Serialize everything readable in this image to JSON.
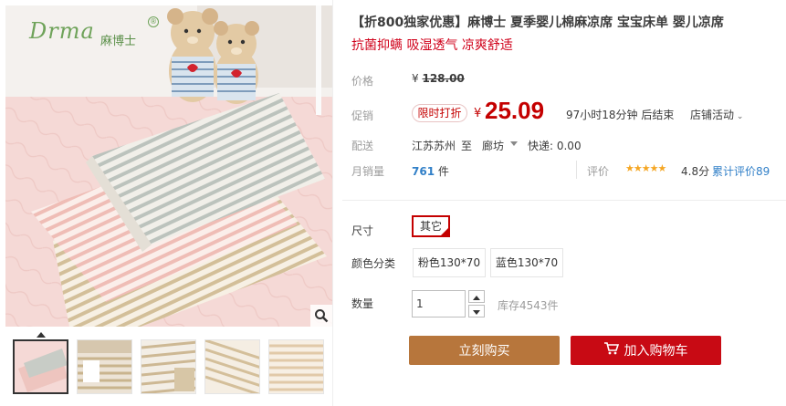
{
  "brand": {
    "logo_script": "Drma",
    "logo_cn": "麻博士",
    "logo_mark": "®"
  },
  "gallery": {
    "main_image": "baby-mat-product-photo",
    "zoom_icon": "magnifier-icon",
    "thumbnails": [
      "thumb-1",
      "thumb-2",
      "thumb-3",
      "thumb-4",
      "thumb-5"
    ],
    "active_index": 0
  },
  "product": {
    "title": "【折800独家优惠】麻博士 夏季婴儿棉麻凉席 宝宝床单 婴儿凉席",
    "subtitle": "抗菌抑螨 吸湿透气 凉爽舒适"
  },
  "price": {
    "label": "价格",
    "original_currency": "¥",
    "original": "128.00",
    "promo_label": "促销",
    "promo_tag": "限时打折",
    "current_currency": "¥",
    "current": "25.09",
    "countdown": "97小时18分钟 后结束",
    "store_activity": "店铺活动"
  },
  "shipping": {
    "label": "配送",
    "from": "江苏苏州",
    "to_word": "至",
    "to_city": "廊坊",
    "fee": "快递: 0.00"
  },
  "sales": {
    "label": "月销量",
    "count": "761",
    "unit": "件",
    "rating_label": "评价",
    "stars": "★★★★★",
    "score": "4.8分",
    "reviews_link": "累计评价89"
  },
  "options": {
    "size_label": "尺寸",
    "size_values": [
      "其它"
    ],
    "color_label": "颜色分类",
    "color_values": [
      "粉色130*70",
      "蓝色130*70"
    ],
    "qty_label": "数量",
    "qty_value": "1",
    "stock": "库存4543件"
  },
  "actions": {
    "buy_now": "立刻购买",
    "add_to_cart": "加入购物车"
  },
  "colors": {
    "price_red": "#c40000",
    "buy_button": "#b7763c",
    "cart_button": "#c80a14",
    "link_blue": "#3280c8"
  }
}
